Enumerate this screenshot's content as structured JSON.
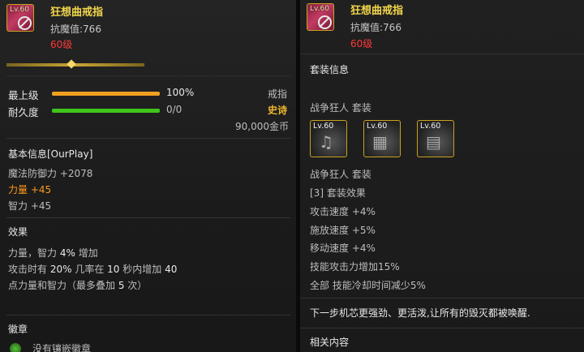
{
  "left": {
    "item_level_badge": "Lv.60",
    "item_name": "狂想曲戒指",
    "resistance": "抗魔值:766",
    "required_level": "60级",
    "rows": {
      "max_level_label": "最上级",
      "max_level_value": "100%",
      "max_level_fill": 1.0,
      "durability_label": "耐久度",
      "durability_value": "0/0",
      "durability_fill": 1.0
    },
    "item_type": "戒指",
    "rarity": "史诗",
    "price": "90,000金币",
    "basic_info_title": "基本信息[OurPlay]",
    "stats": {
      "magic_defense": "魔法防御力 +2078",
      "strength": "力量 +45",
      "intelligence": "智力 +45"
    },
    "effect_title": "效果",
    "effect_lines": [
      [
        "力量，智力 ",
        "4%",
        " 增加"
      ],
      [
        "攻击时有 ",
        "20%",
        " 几率在 ",
        "10",
        " 秒内增加 ",
        "40"
      ],
      [
        "点力量和智力（最多叠加 ",
        "5",
        " 次）"
      ]
    ],
    "emblem_title": "徽章",
    "emblem_text": "没有镶嵌徽章"
  },
  "right": {
    "item_level_badge": "Lv.60",
    "item_name": "狂想曲戒指",
    "resistance": "抗魔值:766",
    "required_level": "60级",
    "set_info_title": "套装信息",
    "set_name_top": "战争狂人 套装",
    "set_items": [
      {
        "level": "Lv.60",
        "icon": "music-notes-icon"
      },
      {
        "level": "Lv.60",
        "icon": "armor-icon"
      },
      {
        "level": "Lv.60",
        "icon": "helmet-icon"
      }
    ],
    "set_name": "战争狂人 套装",
    "set_effect_header": "[3] 套装效果",
    "set_effects": [
      "攻击速度 +4%",
      "施放速度 +5%",
      "移动速度 +4%",
      "技能攻击力增加15%",
      "全部 技能冷却时间减少5%"
    ],
    "flavor_text": "下一步机芯更强劲、更活泼,让所有的毁灭都被唤醒.",
    "related_title": "相关内容"
  },
  "colors": {
    "gold": "#f2d64b",
    "red": "#ff3838",
    "orange": "#ff9a1a",
    "bar_orange": "#f0a020",
    "bar_green": "#3fc51a"
  }
}
